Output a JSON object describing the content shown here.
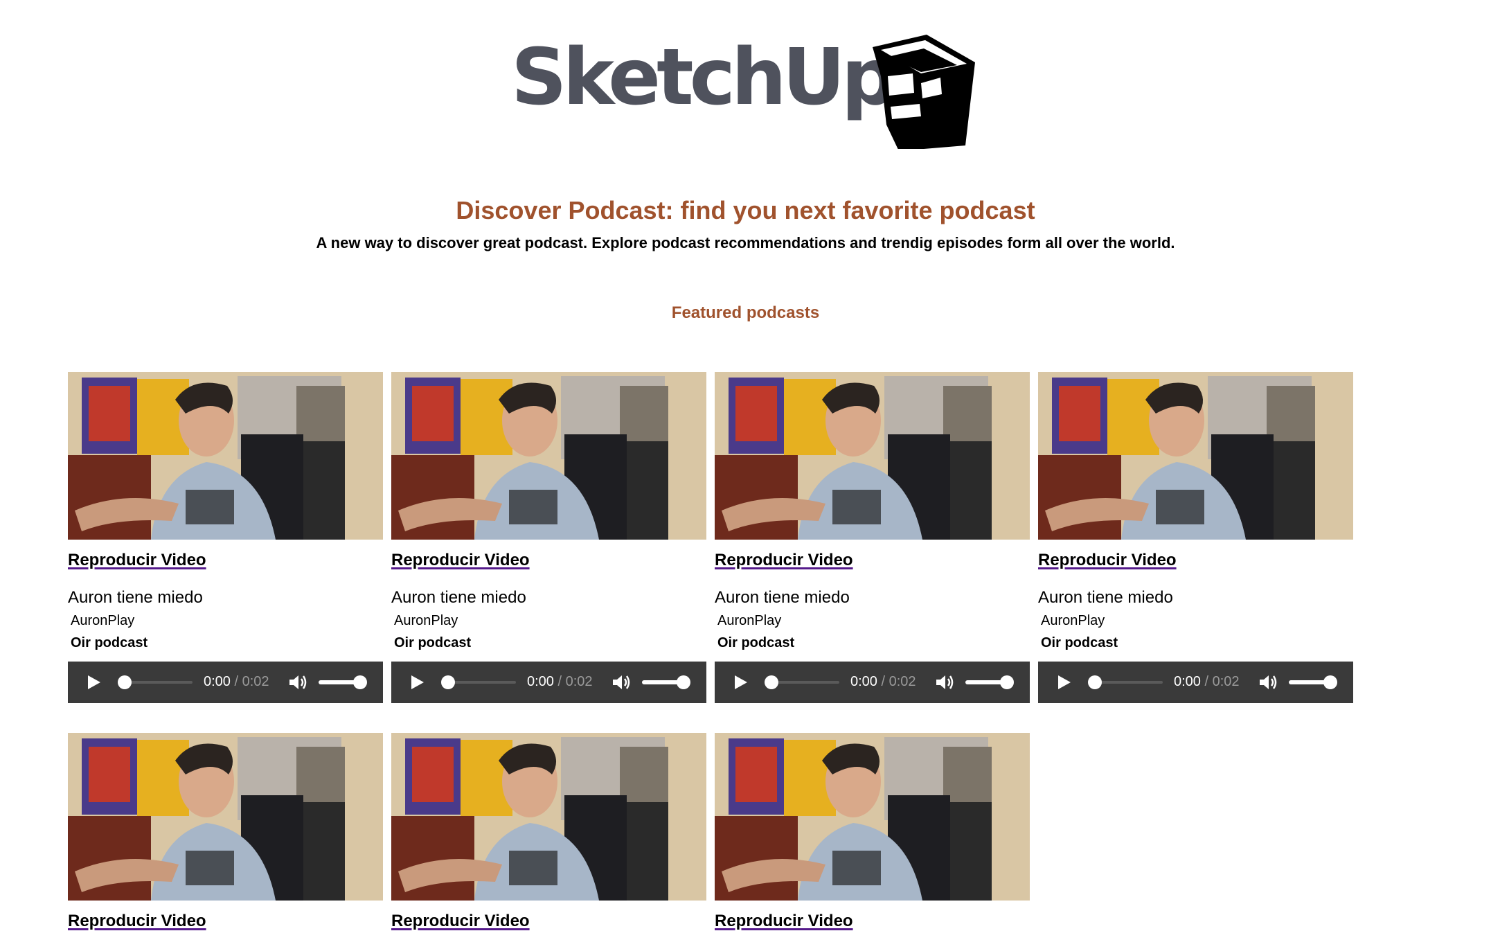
{
  "brand": {
    "name": "SketchUp",
    "logo_icon": "sketchup-cube-icon"
  },
  "hero": {
    "headline": "Discover Podcast: find you next favorite podcast",
    "subline": "A new way to discover great podcast. Explore podcast recommendations and trendig episodes form all over the world."
  },
  "featured": {
    "title": "Featured podcasts",
    "episodes": [
      {
        "video_link": "Reproducir Video",
        "title": "Auron tiene miedo",
        "author": "AuronPlay",
        "listen_label": "Oir podcast",
        "current_time": "0:00",
        "duration": "/ 0:02",
        "progress": 0,
        "volume": 1
      },
      {
        "video_link": "Reproducir Video",
        "title": "Auron tiene miedo",
        "author": "AuronPlay",
        "listen_label": "Oir podcast",
        "current_time": "0:00",
        "duration": "/ 0:02",
        "progress": 0,
        "volume": 1
      },
      {
        "video_link": "Reproducir Video",
        "title": "Auron tiene miedo",
        "author": "AuronPlay",
        "listen_label": "Oir podcast",
        "current_time": "0:00",
        "duration": "/ 0:02",
        "progress": 0,
        "volume": 1
      },
      {
        "video_link": "Reproducir Video",
        "title": "Auron tiene miedo",
        "author": "AuronPlay",
        "listen_label": "Oir podcast",
        "current_time": "0:00",
        "duration": "/ 0:02",
        "progress": 0,
        "volume": 1
      },
      {
        "video_link": "Reproducir Video"
      },
      {
        "video_link": "Reproducir Video"
      },
      {
        "video_link": "Reproducir Video"
      }
    ]
  },
  "colors": {
    "accent": "#a0522d",
    "player_bg": "#3a3a3a",
    "logo_text": "#4f525d",
    "link_underline": "#551a8b"
  }
}
